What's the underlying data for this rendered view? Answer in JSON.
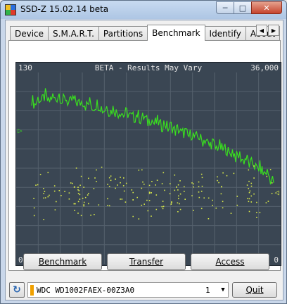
{
  "window": {
    "title": "SSD-Z 15.02.14 beta",
    "controls": {
      "minimize": "─",
      "maximize": "□",
      "close": "✕"
    }
  },
  "tabs": [
    {
      "label": "Device",
      "active": false
    },
    {
      "label": "S.M.A.R.T.",
      "active": false
    },
    {
      "label": "Partitions",
      "active": false
    },
    {
      "label": "Benchmark",
      "active": true
    },
    {
      "label": "Identify",
      "active": false
    },
    {
      "label": "About",
      "active": false
    }
  ],
  "tab_scroll": {
    "left": "◀",
    "right": "▶"
  },
  "chart": {
    "title": "BETA - Results May Vary",
    "left_top_label": "130",
    "right_top_label": "36,000",
    "left_bottom_label": "0",
    "right_bottom_label": "0",
    "left_marker": "▷",
    "right_marker": "◁",
    "colors": {
      "background": "#3a4653",
      "grid": "#55616d",
      "line": "#39e01f",
      "dots": "#d8e84a"
    }
  },
  "chart_data": {
    "type": "line",
    "title": "BETA - Results May Vary",
    "grid": true,
    "series": [
      {
        "values": [
          112,
          108,
          113,
          110,
          115,
          109,
          114,
          111,
          116,
          110,
          113,
          108,
          112,
          110,
          109,
          111,
          107,
          110,
          106,
          109,
          108,
          104,
          107,
          103,
          106,
          102,
          104,
          101,
          103,
          100,
          99,
          102,
          98,
          100,
          96,
          99,
          95,
          97,
          93,
          96,
          92,
          94,
          90,
          92,
          88,
          90,
          86,
          89,
          85,
          87,
          83,
          85,
          80,
          83,
          78,
          81,
          77,
          79,
          74,
          77,
          72,
          74,
          70,
          72,
          67,
          69,
          64,
          66,
          61,
          63,
          58,
          56
        ]
      },
      {
        "style": "scatter-dots",
        "values": [
          63,
          48,
          54,
          45,
          60,
          50,
          47,
          40,
          55,
          52,
          44,
          58,
          49,
          42,
          46,
          51,
          53,
          39,
          57,
          43,
          48,
          50,
          45,
          41,
          55,
          47,
          52,
          44,
          49,
          46,
          53,
          40,
          58,
          48,
          43,
          51,
          45,
          50,
          54,
          42,
          47,
          49,
          52,
          41,
          56,
          44,
          48,
          46,
          50,
          43
        ]
      }
    ],
    "ylim": [
      0,
      130
    ]
  },
  "buttons": {
    "benchmark": "Benchmark",
    "transfer": "Transfer",
    "access": "Access",
    "quit": "Quit"
  },
  "drive": {
    "name": "WDC WD1002FAEX-00Z3A0",
    "number": "1",
    "arrow": "▼",
    "indicator_color": "#f0a000"
  },
  "icons": {
    "refresh": "refresh-icon",
    "app": "app-icon"
  }
}
